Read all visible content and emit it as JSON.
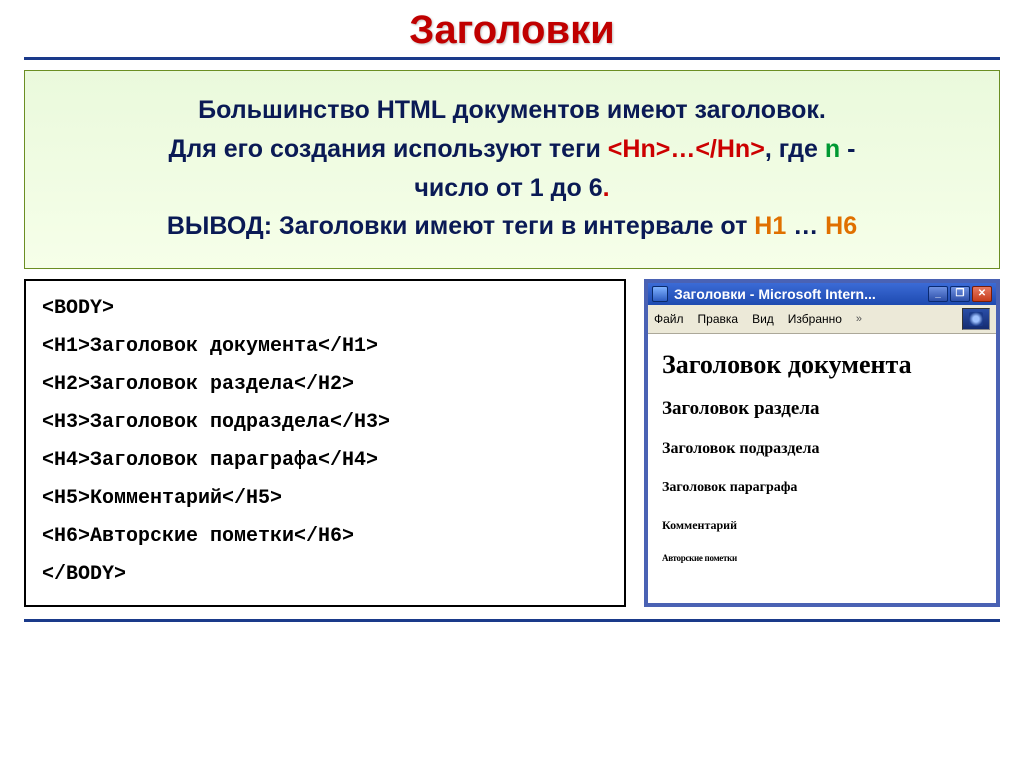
{
  "title": "Заголовки",
  "hero": {
    "line1_a": "Большинство HTML документов имеют заголовок.",
    "line2_a": "Для его создания используют теги ",
    "tag_open": "<Hn>",
    "ellipsis": "…",
    "tag_close": "</Hn>",
    "line2_b": ", где ",
    "n_letter": "n",
    "line2_c": " - ",
    "line3_a": "число от 1 до 6",
    "dot": ".",
    "line4_a": "ВЫВОД: Заголовки имеют теги в интервале от ",
    "h1": "H1",
    "to": " … ",
    "h6": "H6"
  },
  "code": {
    "l1": "<BODY>",
    "l2": "<H1>Заголовок документа</H1>",
    "l3": "<H2>Заголовок раздела</H2>",
    "l4": "<H3>Заголовок подраздела</H3>",
    "l5": "<H4>Заголовок параграфа</H4>",
    "l6": "<H5>Комментарий</H5>",
    "l7": "<H6>Авторские пометки</H6>",
    "l8": "</BODY>"
  },
  "ie": {
    "title": "Заголовки - Microsoft Intern...",
    "menu": {
      "file": "Файл",
      "edit": "Правка",
      "view": "Вид",
      "fav": "Избранно"
    },
    "ctrl": {
      "min": "_",
      "max": "❐",
      "close": "✕"
    },
    "chev": "»",
    "content": {
      "h1": "Заголовок документа",
      "h2": "Заголовок раздела",
      "h3": "Заголовок подраздела",
      "h4": "Заголовок параграфа",
      "h5": "Комментарий",
      "h6": "Авторские пометки"
    }
  }
}
